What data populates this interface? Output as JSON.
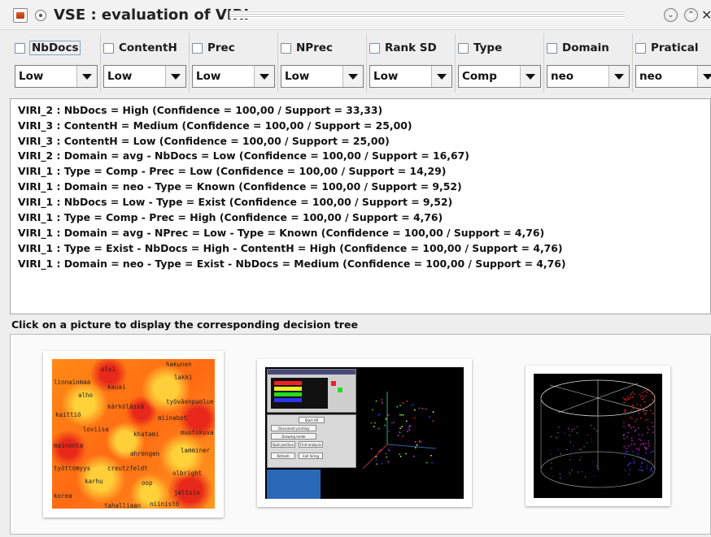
{
  "window": {
    "title": "VSE : evaluation of VIRI",
    "minimize_glyph": "⌄",
    "maximize_glyph": "⌃",
    "close_glyph": "✕"
  },
  "filters": [
    {
      "label": "NbDocs",
      "value": "Low",
      "checked": false
    },
    {
      "label": "ContentH",
      "value": "Low",
      "checked": false
    },
    {
      "label": "Prec",
      "value": "Low",
      "checked": false
    },
    {
      "label": "NPrec",
      "value": "Low",
      "checked": false
    },
    {
      "label": "Rank SD",
      "value": "Low",
      "checked": false
    },
    {
      "label": "Type",
      "value": "Comp",
      "checked": false
    },
    {
      "label": "Domain",
      "value": "neo",
      "checked": false
    },
    {
      "label": "Pratical",
      "value": "neo",
      "checked": false
    }
  ],
  "results": [
    "VIRI_2 : NbDocs = High (Confidence = 100,00 / Support = 33,33)",
    "VIRI_3 : ContentH = Medium (Confidence = 100,00 / Support = 25,00)",
    "VIRI_3 : ContentH = Low (Confidence = 100,00 / Support = 25,00)",
    "VIRI_2 : Domain = avg - NbDocs = Low (Confidence = 100,00 / Support = 16,67)",
    "VIRI_1 : Type = Comp - Prec = Low (Confidence = 100,00 / Support = 14,29)",
    "VIRI_1 : Domain = neo - Type = Known (Confidence = 100,00 / Support = 9,52)",
    "VIRI_1 : NbDocs = Low - Type = Exist (Confidence = 100,00 / Support = 9,52)",
    "VIRI_1 : Type = Comp - Prec = High (Confidence = 100,00 / Support = 4,76)",
    "VIRI_1 : Domain = avg - NPrec = Low - Type = Known (Confidence = 100,00 / Support = 4,76)",
    "VIRI_1 : Type = Exist - NbDocs = High - ContentH = High (Confidence = 100,00 / Support = 4,76)",
    "VIRI_1 : Domain = neo - Type = Exist - NbDocs = Medium (Confidence = 100,00 / Support = 4,76)"
  ],
  "instruction": "Click on a picture to display the corresponding decision tree",
  "pictures": {
    "heatmap_words": [
      "olvi",
      "hakunen",
      "lakki",
      "linnainmaa",
      "kauai",
      "alho",
      "työväenpuolue",
      "kärkölässä",
      "kaittiö",
      "miinabot",
      "loviisa",
      "khatami",
      "muotokuva",
      "mainonta",
      "lamminer",
      "ahrengen",
      "työttömyys",
      "creutzfeldt",
      "olbright",
      "karhu",
      "oop",
      "korea",
      "jeltsin",
      "tahalliaan",
      "niinistö"
    ],
    "viewer_buttons": [
      "Start VR",
      "Document printing",
      "Drawing mode",
      "Spot position",
      "Find analysis",
      "Refresh",
      "Cell hiring"
    ],
    "colors": {
      "heat_hot": "#e8281a",
      "heat_mid": "#ff7a10",
      "heat_light": "#ffd23a"
    }
  }
}
